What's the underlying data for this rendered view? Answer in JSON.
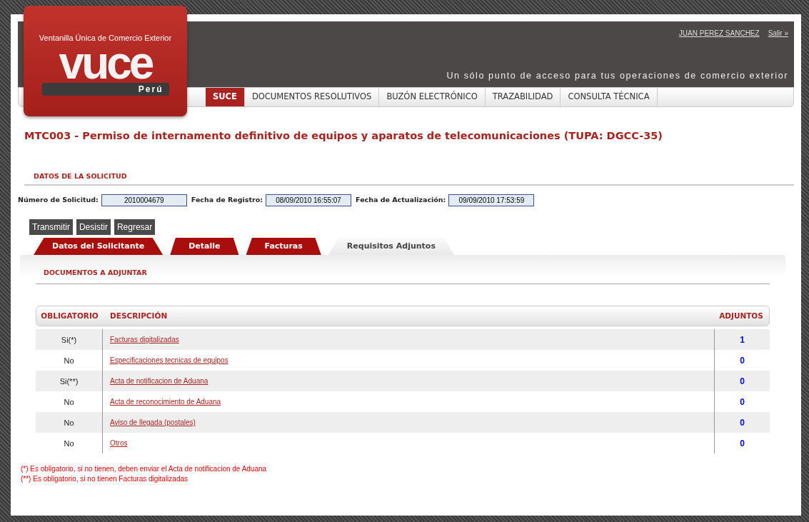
{
  "logo": {
    "tagline": "Ventanilla Única de Comercio Exterior",
    "wordmark": "vuce",
    "country": "Perú"
  },
  "header": {
    "user": "JUAN PEREZ SANCHEZ",
    "logout": "Salir »",
    "slogan": "Un sólo punto de acceso para tus operaciones de comercio exterior"
  },
  "nav": [
    {
      "label": "SUCE",
      "selected": true
    },
    {
      "label": "DOCUMENTOS RESOLUTIVOS",
      "selected": false
    },
    {
      "label": "BUZÓN ELECTRÓNICO",
      "selected": false
    },
    {
      "label": "TRAZABILIDAD",
      "selected": false
    },
    {
      "label": "CONSULTA TÉCNICA",
      "selected": false
    }
  ],
  "page_title": "MTC003 - Permiso de internamento definitivo de equipos y aparatos de telecomunicaciones (TUPA: DGCC-35)",
  "section_title": "DATOS DE LA SOLICITUD",
  "fields": [
    {
      "label": "Número de Solicitud:",
      "value": "2010004679"
    },
    {
      "label": "Fecha de Registro:",
      "value": "08/09/2010 16:55:07"
    },
    {
      "label": "Fecha de Actualización:",
      "value": "09/09/2010 17:53:59"
    }
  ],
  "buttons": [
    "Transmitir",
    "Desistir",
    "Regresar"
  ],
  "tabs": [
    {
      "label": "Datos del Solicitante",
      "selected": false
    },
    {
      "label": "Detalle",
      "selected": false
    },
    {
      "label": "Facturas",
      "selected": false
    },
    {
      "label": "Requisitos Adjuntos",
      "selected": true
    }
  ],
  "documents_title": "DOCUMENTOS A ADJUNTAR",
  "table": {
    "columns": [
      "OBLIGATORIO",
      "DESCRIPCIÓN",
      "ADJUNTOS"
    ],
    "rows": [
      {
        "obligatorio": "Si(*)",
        "descripcion": "Facturas digitalizadas",
        "adjuntos": "1"
      },
      {
        "obligatorio": "No",
        "descripcion": "Especificaciones tecnicas de equipos",
        "adjuntos": "0"
      },
      {
        "obligatorio": "Si(**)",
        "descripcion": "Acta de notificacion de Aduana",
        "adjuntos": "0"
      },
      {
        "obligatorio": "No",
        "descripcion": "Acta de reconocimiento de Aduana",
        "adjuntos": "0"
      },
      {
        "obligatorio": "No",
        "descripcion": "Aviso de llegada (postales)",
        "adjuntos": "0"
      },
      {
        "obligatorio": "No",
        "descripcion": "Otros",
        "adjuntos": "0"
      }
    ]
  },
  "notes": [
    "(*) Es obligatorio, si no tienen, deben enviar el Acta de notificacion de Aduana",
    "(**) Es obligatorio, si no tienen Facturas digitalizadas"
  ]
}
